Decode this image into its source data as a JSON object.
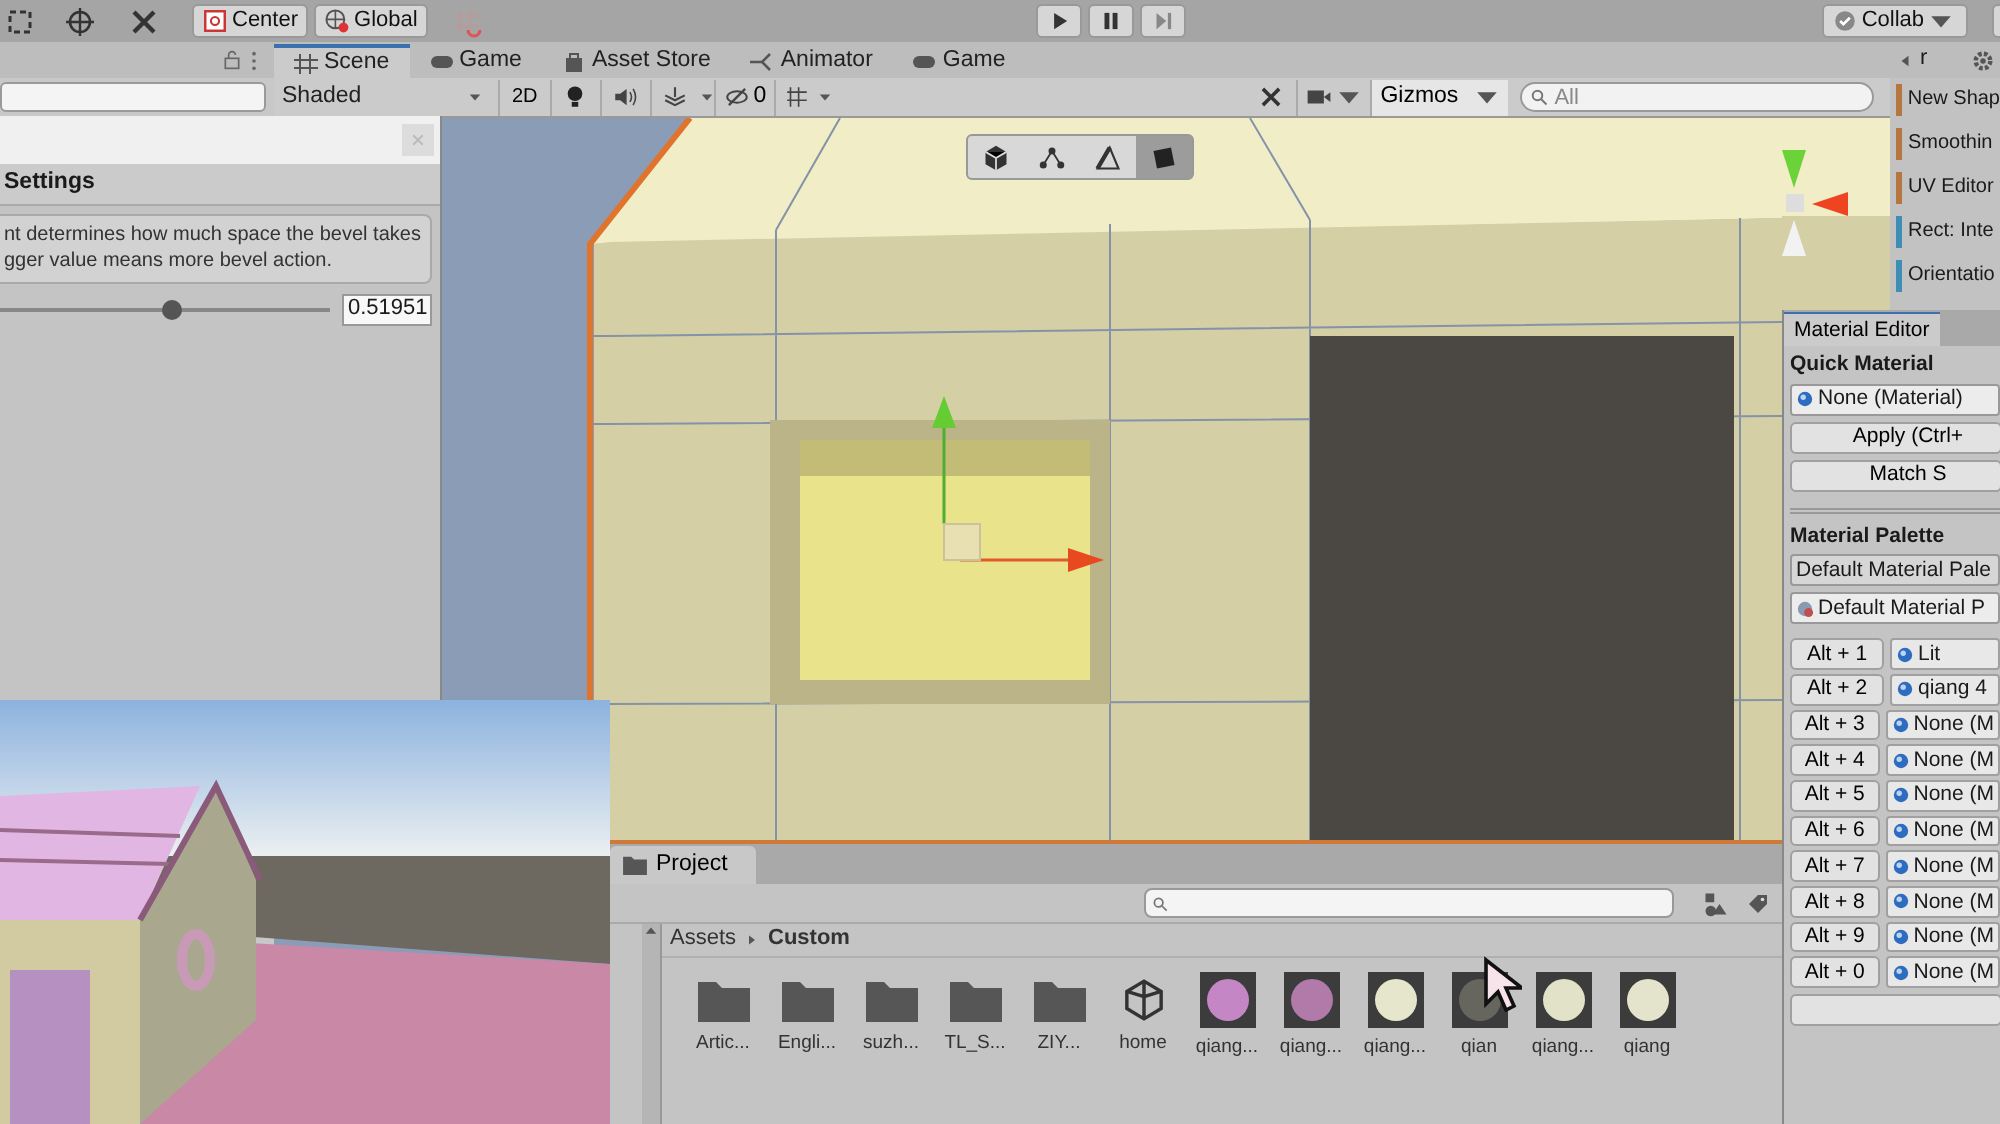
{
  "toolbar": {
    "pivot": "Center",
    "space": "Global",
    "collab": "Collab"
  },
  "scene_tabs": [
    {
      "label": "Scene",
      "kind": "scene",
      "selected": true
    },
    {
      "label": "Game",
      "kind": "game",
      "selected": false
    },
    {
      "label": "Asset Store",
      "kind": "store",
      "selected": false
    },
    {
      "label": "Animator",
      "kind": "animator",
      "selected": false
    },
    {
      "label": "Game",
      "kind": "game",
      "selected": false
    }
  ],
  "scene_toolbar": {
    "draw_mode": "Shaded",
    "mode_2d": "2D",
    "hidden_count": "0",
    "gizmos": "Gizmos",
    "search": {
      "placeholder": "All"
    }
  },
  "selection_modes": [
    {
      "kind": "object",
      "selected": false
    },
    {
      "kind": "vertex",
      "selected": false
    },
    {
      "kind": "edge",
      "selected": false
    },
    {
      "kind": "face",
      "selected": true
    }
  ],
  "bevel_window": {
    "heading": "Settings",
    "description_lines": [
      "nt determines how much space the bevel takes",
      "gger value means more bevel action."
    ],
    "slider": {
      "level": 0.52
    },
    "value": "0.51951"
  },
  "inspector": {
    "tab": "r",
    "items": [
      {
        "label": "New Shap",
        "color": "#b5763f"
      },
      {
        "label": "Smoothin",
        "color": "#b5763f"
      },
      {
        "label": "UV Editor",
        "color": "#b5763f"
      },
      {
        "label": "Rect: Inte",
        "color": "#3d8db5"
      },
      {
        "label": "Orientatio",
        "color": "#3d8db5"
      }
    ]
  },
  "material_editor": {
    "tab": "Material Editor",
    "quick_heading": "Quick Material",
    "quick_material": "None (Material)",
    "buttons": [
      "Apply (Ctrl+",
      "Match S"
    ],
    "palette_heading": "Material Palette",
    "palette_dropdown": "Default Material Pale",
    "palette_asset": "Default Material P",
    "slots": [
      {
        "shortcut": "Alt + 1",
        "material": "Lit"
      },
      {
        "shortcut": "Alt + 2",
        "material": "qiang 4"
      },
      {
        "shortcut": "Alt + 3",
        "material": "None (M"
      },
      {
        "shortcut": "Alt + 4",
        "material": "None (M"
      },
      {
        "shortcut": "Alt + 5",
        "material": "None (M"
      },
      {
        "shortcut": "Alt + 6",
        "material": "None (M"
      },
      {
        "shortcut": "Alt + 7",
        "material": "None (M"
      },
      {
        "shortcut": "Alt + 8",
        "material": "None (M"
      },
      {
        "shortcut": "Alt + 9",
        "material": "None (M"
      },
      {
        "shortcut": "Alt + 0",
        "material": "None (M"
      }
    ]
  },
  "project": {
    "tab": "Project",
    "breadcrumb": [
      "Assets",
      "Custom"
    ],
    "assets": [
      {
        "name": "Artic...",
        "kind": "folder"
      },
      {
        "name": "Engli...",
        "kind": "folder"
      },
      {
        "name": "suzh...",
        "kind": "folder"
      },
      {
        "name": "TL_S...",
        "kind": "folder"
      },
      {
        "name": "ZIY...",
        "kind": "folder"
      },
      {
        "name": "home",
        "kind": "scene"
      },
      {
        "name": "qiang...",
        "kind": "material",
        "color": "#c486c4"
      },
      {
        "name": "qiang...",
        "kind": "material",
        "color": "#b27aa8"
      },
      {
        "name": "qiang...",
        "kind": "material",
        "color": "#e6e6cc"
      },
      {
        "name": "qian",
        "kind": "material",
        "color": "#66665f"
      },
      {
        "name": "qiang...",
        "kind": "material",
        "color": "#e2e2c8"
      },
      {
        "name": "qiang",
        "kind": "material",
        "color": "#e4e4cc"
      }
    ]
  }
}
